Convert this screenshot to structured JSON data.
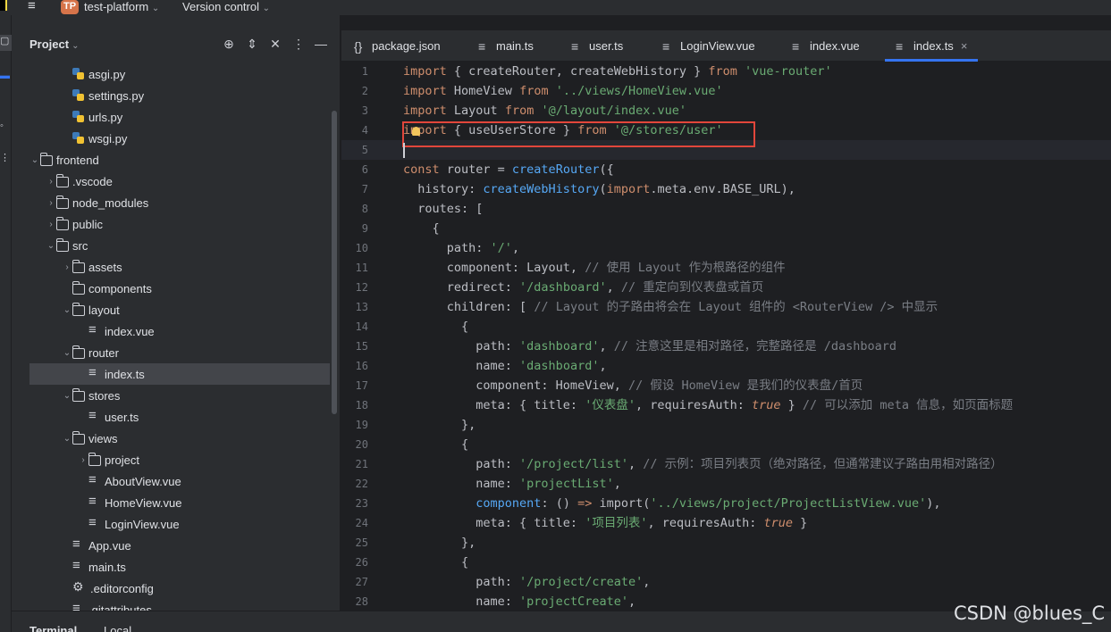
{
  "titlebar": {
    "project_badge": "TP",
    "project_name": "test-platform",
    "project_chevron": "⌄",
    "vcs_label": "Version control",
    "vcs_chevron": "⌄"
  },
  "project_panel": {
    "title": "Project",
    "chevron": "⌄",
    "icons": [
      "target-icon",
      "expand-collapse-icon",
      "close-icon",
      "more-icon",
      "minimize-icon"
    ],
    "tree": [
      {
        "label": "asgi.py",
        "type": "python",
        "arrow": ""
      },
      {
        "label": "settings.py",
        "type": "python",
        "arrow": ""
      },
      {
        "label": "urls.py",
        "type": "python",
        "arrow": ""
      },
      {
        "label": "wsgi.py",
        "type": "python",
        "arrow": ""
      },
      {
        "label": "frontend",
        "type": "folder",
        "arrow": "⌄"
      },
      {
        "label": ".vscode",
        "type": "folder",
        "arrow": "›"
      },
      {
        "label": "node_modules",
        "type": "folder",
        "arrow": "›"
      },
      {
        "label": "public",
        "type": "folder",
        "arrow": "›"
      },
      {
        "label": "src",
        "type": "folder",
        "arrow": "⌄"
      },
      {
        "label": "assets",
        "type": "folder",
        "arrow": "›"
      },
      {
        "label": "components",
        "type": "folder",
        "arrow": ""
      },
      {
        "label": "layout",
        "type": "folder",
        "arrow": "⌄"
      },
      {
        "label": "index.vue",
        "type": "file",
        "arrow": ""
      },
      {
        "label": "router",
        "type": "folder",
        "arrow": "⌄"
      },
      {
        "label": "index.ts",
        "type": "file",
        "arrow": "",
        "selected": true
      },
      {
        "label": "stores",
        "type": "folder",
        "arrow": "⌄"
      },
      {
        "label": "user.ts",
        "type": "file",
        "arrow": ""
      },
      {
        "label": "views",
        "type": "folder",
        "arrow": "⌄"
      },
      {
        "label": "project",
        "type": "folder",
        "arrow": "›"
      },
      {
        "label": "AboutView.vue",
        "type": "file",
        "arrow": ""
      },
      {
        "label": "HomeView.vue",
        "type": "file",
        "arrow": ""
      },
      {
        "label": "LoginView.vue",
        "type": "file",
        "arrow": ""
      },
      {
        "label": "App.vue",
        "type": "file",
        "arrow": ""
      },
      {
        "label": "main.ts",
        "type": "file",
        "arrow": ""
      },
      {
        "label": ".editorconfig",
        "type": "config",
        "arrow": ""
      },
      {
        "label": ".gitattributes",
        "type": "file",
        "arrow": ""
      }
    ]
  },
  "bottom": {
    "terminal_label": "Terminal",
    "local_label": "Local"
  },
  "tabs": [
    {
      "label": "package.json",
      "icon": "json-icon",
      "glyph": "{}"
    },
    {
      "label": "main.ts",
      "icon": "file-icon",
      "glyph": "≡"
    },
    {
      "label": "user.ts",
      "icon": "file-icon",
      "glyph": "≡"
    },
    {
      "label": "LoginView.vue",
      "icon": "file-icon",
      "glyph": "≡"
    },
    {
      "label": "index.vue",
      "icon": "file-icon",
      "glyph": "≡"
    },
    {
      "label": "index.ts",
      "icon": "file-icon",
      "glyph": "≡",
      "active": true,
      "close": "×"
    }
  ],
  "editor": {
    "line_numbers": [
      "1",
      "2",
      "3",
      "4",
      "5",
      "6",
      "7",
      "8",
      "9",
      "10",
      "11",
      "12",
      "13",
      "14",
      "15",
      "16",
      "17",
      "18",
      "19",
      "20",
      "21",
      "22",
      "23",
      "24",
      "25",
      "26",
      "27",
      "28"
    ],
    "lines": [
      [
        {
          "t": "import",
          "c": "kw"
        },
        {
          "t": " { createRouter, createWebHistory } "
        },
        {
          "t": "from",
          "c": "kw"
        },
        {
          "t": " "
        },
        {
          "t": "'vue-router'",
          "c": "str"
        }
      ],
      [
        {
          "t": "import",
          "c": "kw"
        },
        {
          "t": " HomeView "
        },
        {
          "t": "from",
          "c": "kw"
        },
        {
          "t": " "
        },
        {
          "t": "'../views/HomeView.vue'",
          "c": "str"
        }
      ],
      [
        {
          "t": "import",
          "c": "kw"
        },
        {
          "t": " Layout "
        },
        {
          "t": "from",
          "c": "kw"
        },
        {
          "t": " "
        },
        {
          "t": "'@/layout/index.vue'",
          "c": "str"
        }
      ],
      [
        {
          "t": "import",
          "c": "kw"
        },
        {
          "t": " { useUserStore } "
        },
        {
          "t": "from",
          "c": "kw"
        },
        {
          "t": " "
        },
        {
          "t": "'@/stores/user'",
          "c": "str"
        }
      ],
      [
        {
          "t": ""
        }
      ],
      [
        {
          "t": "const",
          "c": "kw"
        },
        {
          "t": " router = "
        },
        {
          "t": "createRouter",
          "c": "fn"
        },
        {
          "t": "({"
        }
      ],
      [
        {
          "t": "  history: "
        },
        {
          "t": "createWebHistory",
          "c": "fn"
        },
        {
          "t": "("
        },
        {
          "t": "import",
          "c": "kw"
        },
        {
          "t": ".meta.env.BASE_URL),"
        }
      ],
      [
        {
          "t": "  routes: ["
        }
      ],
      [
        {
          "t": "    {"
        }
      ],
      [
        {
          "t": "      path: "
        },
        {
          "t": "'/'",
          "c": "str"
        },
        {
          "t": ","
        }
      ],
      [
        {
          "t": "      component: Layout, "
        },
        {
          "t": "// 使用 Layout 作为根路径的组件",
          "c": "cm"
        }
      ],
      [
        {
          "t": "      redirect: "
        },
        {
          "t": "'/dashboard'",
          "c": "str"
        },
        {
          "t": ", "
        },
        {
          "t": "// 重定向到仪表盘或首页",
          "c": "cm"
        }
      ],
      [
        {
          "t": "      children: [ "
        },
        {
          "t": "// Layout 的子路由将会在 Layout 组件的 <RouterView /> 中显示",
          "c": "cm"
        }
      ],
      [
        {
          "t": "        {"
        }
      ],
      [
        {
          "t": "          path: "
        },
        {
          "t": "'dashboard'",
          "c": "str"
        },
        {
          "t": ", "
        },
        {
          "t": "// 注意这里是相对路径，完整路径是 /dashboard",
          "c": "cm"
        }
      ],
      [
        {
          "t": "          name: "
        },
        {
          "t": "'dashboard'",
          "c": "str"
        },
        {
          "t": ","
        }
      ],
      [
        {
          "t": "          component: HomeView, "
        },
        {
          "t": "// 假设 HomeView 是我们的仪表盘/首页",
          "c": "cm"
        }
      ],
      [
        {
          "t": "          meta: { title: "
        },
        {
          "t": "'仪表盘'",
          "c": "str"
        },
        {
          "t": ", requiresAuth: "
        },
        {
          "t": "true",
          "c": "it"
        },
        {
          "t": " } "
        },
        {
          "t": "// 可以添加 meta 信息，如页面标题",
          "c": "cm"
        }
      ],
      [
        {
          "t": "        },"
        }
      ],
      [
        {
          "t": "        {"
        }
      ],
      [
        {
          "t": "          path: "
        },
        {
          "t": "'/project/list'",
          "c": "str"
        },
        {
          "t": ", "
        },
        {
          "t": "// 示例：项目列表页（绝对路径，但通常建议子路由用相对路径）",
          "c": "cm"
        }
      ],
      [
        {
          "t": "          name: "
        },
        {
          "t": "'projectList'",
          "c": "str"
        },
        {
          "t": ","
        }
      ],
      [
        {
          "t": "          component",
          "c": "fn"
        },
        {
          "t": ": () "
        },
        {
          "t": "=>",
          "c": "kw"
        },
        {
          "t": " import("
        },
        {
          "t": "'../views/project/ProjectListView.vue'",
          "c": "str"
        },
        {
          "t": "),"
        }
      ],
      [
        {
          "t": "          meta: { title: "
        },
        {
          "t": "'项目列表'",
          "c": "str"
        },
        {
          "t": ", requiresAuth: "
        },
        {
          "t": "true",
          "c": "it"
        },
        {
          "t": " }"
        }
      ],
      [
        {
          "t": "        },"
        }
      ],
      [
        {
          "t": "        {"
        }
      ],
      [
        {
          "t": "          path: "
        },
        {
          "t": "'/project/create'",
          "c": "str"
        },
        {
          "t": ","
        }
      ],
      [
        {
          "t": "          name: "
        },
        {
          "t": "'projectCreate'",
          "c": "str"
        },
        {
          "t": ","
        }
      ]
    ]
  },
  "watermark": "CSDN @blues_C"
}
